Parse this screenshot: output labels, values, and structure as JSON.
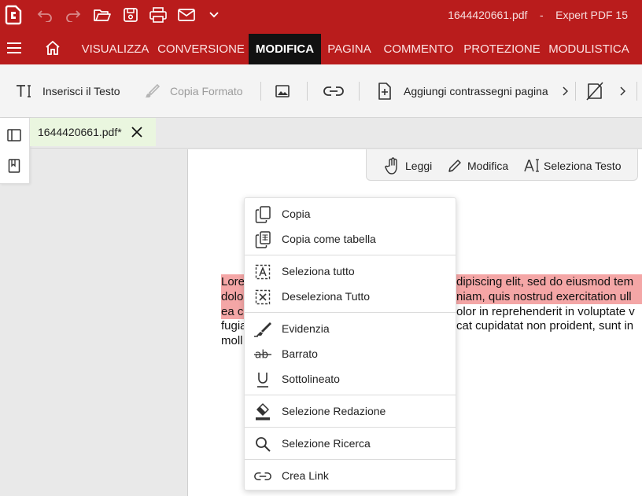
{
  "window": {
    "title": "1644420661.pdf    -    Expert PDF 15"
  },
  "quick_access": [
    "undo-icon",
    "redo-icon",
    "open-folder-icon",
    "save-icon",
    "print-icon",
    "mail-icon",
    "chevron-down-icon"
  ],
  "ribbon": {
    "tabs": [
      {
        "label": "VISUALIZZA"
      },
      {
        "label": "CONVERSIONE"
      },
      {
        "label": "MODIFICA",
        "active": true
      },
      {
        "label": "PAGINA"
      },
      {
        "label": "COMMENTO"
      },
      {
        "label": "PROTEZIONE"
      },
      {
        "label": "MODULISTICA"
      }
    ]
  },
  "toolbar": {
    "insert_text": "Inserisci il Testo",
    "copy_format": "Copia Formato",
    "add_page_marks": "Aggiungi contrassegni pagina"
  },
  "document_tab": {
    "name": "1644420661.pdf*"
  },
  "modes": {
    "read": "Leggi",
    "edit": "Modifica",
    "select_text": "Seleziona Testo"
  },
  "document": {
    "lines": [
      {
        "left": "Lore",
        "right": "dipiscing elit, sed do eiusmod tem"
      },
      {
        "left": "dolo",
        "right": "niam, quis nostrud exercitation ull"
      },
      {
        "left": "ea c",
        "right": "olor in reprehenderit in voluptate v"
      },
      {
        "left": "fugia",
        "right": "cat cupidatat non proident, sunt in"
      },
      {
        "left": "moll",
        "right": ""
      }
    ]
  },
  "context_menu": {
    "items": [
      {
        "label": "Copia",
        "icon": "copy-icon"
      },
      {
        "label": "Copia come tabella",
        "icon": "copy-table-icon"
      },
      {
        "label": "Seleziona tutto",
        "icon": "select-all-icon"
      },
      {
        "label": "Deseleziona Tutto",
        "icon": "deselect-all-icon"
      },
      {
        "label": "Evidenzia",
        "icon": "highlight-pen-icon"
      },
      {
        "label": "Barrato",
        "icon": "strikethrough-icon"
      },
      {
        "label": "Sottolineato",
        "icon": "underline-icon"
      },
      {
        "label": "Selezione Redazione",
        "icon": "redaction-eraser-icon"
      },
      {
        "label": "Selezione Ricerca",
        "icon": "search-icon"
      },
      {
        "label": "Crea Link",
        "icon": "link-icon"
      }
    ]
  },
  "colors": {
    "brand": "#b91c1c",
    "active_tab": "#111111",
    "highlight": "#f4a6a6",
    "doc_tab_bg": "#eaf6df"
  }
}
